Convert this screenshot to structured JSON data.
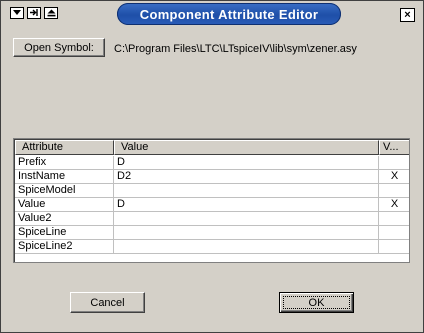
{
  "window": {
    "title": "Component Attribute Editor",
    "sys_icons": [
      "dropdown-arrow-icon",
      "pin-icon",
      "eject-icon"
    ],
    "close_glyph": "×"
  },
  "symbol": {
    "open_button_label": "Open Symbol:",
    "path": "C:\\Program Files\\LTC\\LTspiceIV\\lib\\sym\\zener.asy"
  },
  "table": {
    "headers": [
      "Attribute",
      "Value",
      "V..."
    ],
    "rows": [
      {
        "attribute": "Prefix",
        "value": "D",
        "visible": ""
      },
      {
        "attribute": "InstName",
        "value": "D2",
        "visible": "X"
      },
      {
        "attribute": "SpiceModel",
        "value": "",
        "visible": ""
      },
      {
        "attribute": "Value",
        "value": "D",
        "visible": "X"
      },
      {
        "attribute": "Value2",
        "value": "",
        "visible": ""
      },
      {
        "attribute": "SpiceLine",
        "value": "",
        "visible": ""
      },
      {
        "attribute": "SpiceLine2",
        "value": "",
        "visible": ""
      }
    ]
  },
  "buttons": {
    "cancel_label": "Cancel",
    "ok_label": "OK"
  },
  "colors": {
    "title_gradient": "#1e4fa8",
    "face": "#d4d0c8"
  }
}
